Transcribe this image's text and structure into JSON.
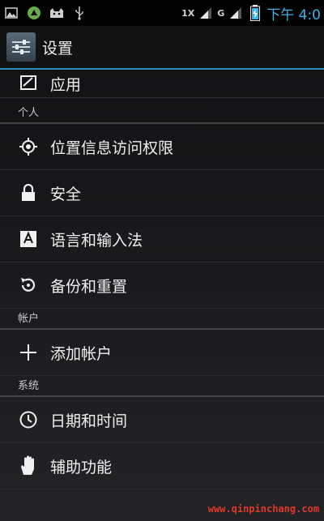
{
  "status_bar": {
    "left_icons": [
      "image-icon",
      "android-robot-icon",
      "android-cat-icon",
      "usb-icon"
    ],
    "network_1x": "1X",
    "network_g": "G",
    "time": "下午 4:0"
  },
  "action_bar": {
    "title": "设置",
    "icon": "settings-sliders-icon"
  },
  "list": {
    "apps_label": "应用",
    "personal_header": "个人",
    "location_label": "位置信息访问权限",
    "security_label": "安全",
    "language_label": "语言和输入法",
    "backup_label": "备份和重置",
    "accounts_header": "帐户",
    "add_account_label": "添加帐户",
    "system_header": "系统",
    "datetime_label": "日期和时间",
    "accessibility_label": "辅助功能"
  },
  "watermark": "www.qinpinchang.com",
  "colors": {
    "accent": "#33b5e5",
    "divider": "#2b2c2f",
    "watermark": "#e03a2a"
  }
}
